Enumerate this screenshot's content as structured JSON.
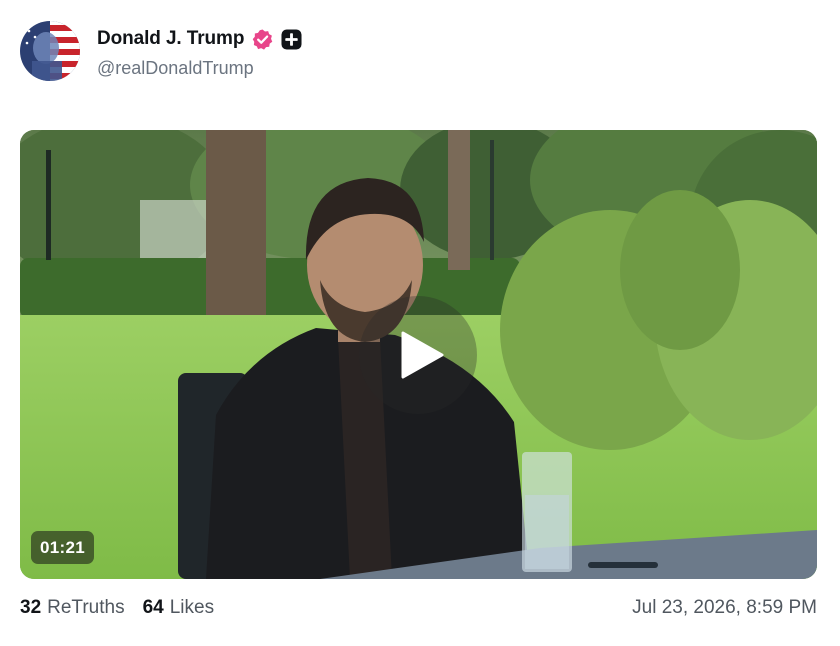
{
  "author": {
    "display_name": "Donald J. Trump",
    "handle": "@realDonaldTrump",
    "verified_icon": "verified-badge-icon",
    "plus_badge_icon": "plus-badge-icon",
    "verified_color": "#e8458a"
  },
  "media": {
    "duration": "01:21",
    "play_icon": "play-icon"
  },
  "stats": {
    "retruths_count": "32",
    "retruths_label": "ReTruths",
    "likes_count": "64",
    "likes_label": "Likes"
  },
  "timestamp": "Jul 23, 2026, 8:59 PM"
}
